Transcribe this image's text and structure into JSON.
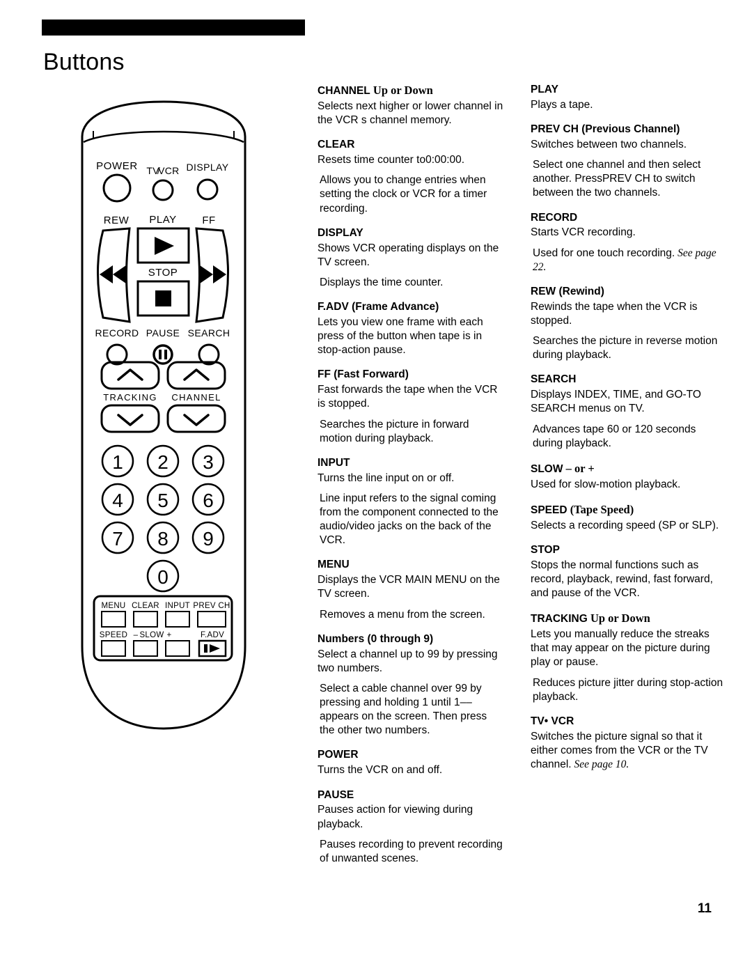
{
  "page": {
    "title": "Buttons",
    "number": "11"
  },
  "remote": {
    "label_power": "POWER",
    "label_tvvcr": "TV/VCR",
    "label_tv": "TV",
    "label_vcr": "VCR",
    "label_display": "DISPLAY",
    "label_rew": "REW",
    "label_play": "PLAY",
    "label_ff": "FF",
    "label_stop": "STOP",
    "label_record": "RECORD",
    "label_pause": "PAUSE",
    "label_search": "SEARCH",
    "label_tracking": "TRACKING",
    "label_channel": "CHANNEL",
    "keys": [
      "1",
      "2",
      "3",
      "4",
      "5",
      "6",
      "7",
      "8",
      "9",
      "0"
    ],
    "label_menu": "MENU",
    "label_clear": "CLEAR",
    "label_input": "INPUT",
    "label_prevch": "PREV CH",
    "label_speed": "SPEED",
    "label_minus": "–",
    "label_slow": "SLOW",
    "label_plus": "+",
    "label_fadv": "F.ADV"
  },
  "middle_column": [
    {
      "heading_bold": "CHANNEL",
      "heading_serif": " Up or Down",
      "paragraphs": [
        "Selects next higher or lower channel in the VCR s channel memory."
      ]
    },
    {
      "heading_bold": "CLEAR",
      "heading_serif": "",
      "paragraphs": [
        "Resets time counter to0:00:00.",
        "Allows you to change entries when setting the clock or VCR for a timer recording."
      ]
    },
    {
      "heading_bold": "DISPLAY",
      "heading_serif": "",
      "paragraphs": [
        "Shows VCR operating displays on the TV screen.",
        "Displays the time counter."
      ]
    },
    {
      "heading_bold": "F.ADV (Frame Advance)",
      "heading_serif": "",
      "paragraphs": [
        "Lets you view one frame with each press of the button when tape is in stop-action pause."
      ]
    },
    {
      "heading_bold": "FF (Fast Forward)",
      "heading_serif": "",
      "paragraphs": [
        "Fast forwards the tape when the VCR is stopped.",
        "Searches the picture in forward motion during playback."
      ]
    },
    {
      "heading_bold": "INPUT",
      "heading_serif": "",
      "paragraphs": [
        "Turns the line input on or off.",
        "Line input refers to the signal coming from the component connected to the audio/video jacks on the back of the VCR."
      ]
    },
    {
      "heading_bold": "MENU",
      "heading_serif": "",
      "paragraphs": [
        "Displays the VCR MAIN MENU on the TV screen.",
        "Removes a menu from the screen."
      ]
    },
    {
      "heading_bold": "Numbers (0 through 9)",
      "heading_serif": "",
      "paragraphs": [
        "Select a channel up to 99 by pressing two numbers.",
        "Select a cable channel over 99 by pressing and holding  1 until  1–– appears on the screen.  Then press the other two numbers."
      ]
    },
    {
      "heading_bold": "POWER",
      "heading_serif": "",
      "paragraphs": [
        "Turns the VCR on and off."
      ]
    },
    {
      "heading_bold": "PAUSE",
      "heading_serif": "",
      "paragraphs": [
        "Pauses action for viewing during playback.",
        "Pauses recording to prevent recording of unwanted scenes."
      ]
    }
  ],
  "right_column": [
    {
      "heading_bold": "PLAY",
      "heading_serif": "",
      "paragraphs": [
        "Plays a tape."
      ]
    },
    {
      "heading_bold": "PREV CH (Previous Channel)",
      "heading_serif": "",
      "paragraphs": [
        "Switches between two channels.",
        "Select one channel and then select another.  PressPREV CH to switch between the two channels."
      ]
    },
    {
      "heading_bold": "RECORD",
      "heading_serif": "",
      "paragraphs": [
        "Starts VCR recording.",
        "Used for one touch recording."
      ],
      "see_ref": "See page 22."
    },
    {
      "heading_bold": "REW (Rewind)",
      "heading_serif": "",
      "paragraphs": [
        "Rewinds the tape when the VCR is stopped.",
        "Searches the picture in reverse motion during playback."
      ]
    },
    {
      "heading_bold": "SEARCH",
      "heading_serif": "",
      "paragraphs": [
        "Displays INDEX, TIME, and GO-TO SEARCH menus on TV.",
        "Advances tape  60 or 120 seconds during playback."
      ]
    },
    {
      "heading_bold": "SLOW",
      "heading_serif": " – or +",
      "paragraphs": [
        "Used for slow-motion playback."
      ]
    },
    {
      "heading_bold": "SPEED",
      "heading_serif": " (Tape Speed)",
      "paragraphs": [
        "Selects a recording speed (SP or SLP)."
      ]
    },
    {
      "heading_bold": "STOP",
      "heading_serif": "",
      "paragraphs": [
        "Stops the normal functions such as record, playback, rewind, fast forward, and pause of the VCR."
      ]
    },
    {
      "heading_bold": "TRACKING",
      "heading_serif": " Up or Down",
      "paragraphs": [
        "Lets you manually reduce the streaks that may appear on the picture during play or pause.",
        "Reduces picture  jitter  during stop-action playback."
      ]
    },
    {
      "heading_bold": "TV• VCR",
      "heading_serif": "",
      "paragraphs": [
        "Switches the picture signal so that it either comes from the VCR or the TV channel."
      ],
      "see_ref": "See page 10."
    }
  ]
}
